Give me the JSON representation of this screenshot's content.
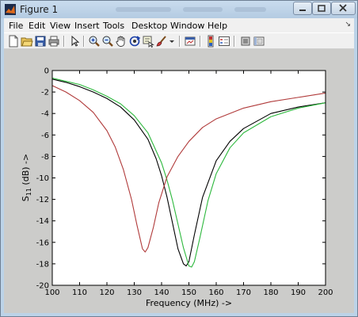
{
  "window": {
    "title": "Figure 1"
  },
  "menu": {
    "items": [
      "File",
      "Edit",
      "View",
      "Insert",
      "Tools",
      "Desktop",
      "Window",
      "Help"
    ]
  },
  "toolbar": {
    "icons": [
      "new-figure-icon",
      "open-file-icon",
      "save-icon",
      "print-icon",
      "edit-plot-arrow-icon",
      "zoom-in-icon",
      "zoom-out-icon",
      "pan-hand-icon",
      "rotate-3d-icon",
      "data-cursor-icon",
      "brush-icon",
      "link-plot-icon",
      "colorbar-icon",
      "legend-icon",
      "hide-plot-tools-icon",
      "show-plot-tools-icon"
    ]
  },
  "colors": {
    "titlebar": "#bcd3e8",
    "figure_bg": "#ccccca",
    "axes_bg": "#ffffff",
    "series_black": "#000000",
    "series_green": "#2db83d",
    "series_red": "#b03a3a"
  },
  "chart_data": {
    "type": "line",
    "title": "",
    "xlabel": "Frequency (MHz) ->",
    "ylabel": "S11 (dB) ->",
    "ylabel_main": "S",
    "ylabel_sub": "11",
    "ylabel_rest": " (dB) ->",
    "xlim": [
      100,
      200
    ],
    "ylim": [
      -20,
      0
    ],
    "xticks": [
      100,
      110,
      120,
      130,
      140,
      150,
      160,
      170,
      180,
      190,
      200
    ],
    "yticks": [
      0,
      -2,
      -4,
      -6,
      -8,
      -10,
      -12,
      -14,
      -16,
      -18,
      -20
    ],
    "grid": false,
    "series": [
      {
        "color": "#000000",
        "x": [
          100,
          105,
          110,
          115,
          120,
          125,
          130,
          135,
          138,
          140,
          142,
          144,
          146,
          148,
          149,
          150,
          152,
          155,
          160,
          165,
          170,
          180,
          190,
          200
        ],
        "y": [
          -0.8,
          -1.1,
          -1.5,
          -2.0,
          -2.6,
          -3.4,
          -4.6,
          -6.4,
          -8.2,
          -9.8,
          -11.8,
          -14.2,
          -16.6,
          -18.0,
          -18.2,
          -17.8,
          -15.3,
          -11.8,
          -8.4,
          -6.6,
          -5.4,
          -4.0,
          -3.4,
          -3.0
        ]
      },
      {
        "color": "#2db83d",
        "x": [
          100,
          105,
          110,
          115,
          120,
          125,
          130,
          135,
          140,
          142,
          144,
          146,
          148,
          150,
          151,
          152,
          154,
          157,
          160,
          165,
          170,
          180,
          190,
          200
        ],
        "y": [
          -0.7,
          -1.0,
          -1.3,
          -1.8,
          -2.4,
          -3.1,
          -4.2,
          -5.8,
          -8.6,
          -10.2,
          -12.1,
          -14.3,
          -16.5,
          -18.2,
          -18.3,
          -17.8,
          -15.6,
          -12.1,
          -9.6,
          -7.2,
          -5.8,
          -4.3,
          -3.5,
          -3.0
        ]
      },
      {
        "color": "#b03a3a",
        "x": [
          100,
          105,
          110,
          115,
          120,
          123,
          126,
          129,
          131,
          133,
          134,
          135,
          137,
          139,
          142,
          146,
          150,
          155,
          160,
          170,
          180,
          190,
          200
        ],
        "y": [
          -1.4,
          -2.0,
          -2.8,
          -3.9,
          -5.6,
          -7.1,
          -9.2,
          -12.0,
          -14.4,
          -16.6,
          -16.9,
          -16.5,
          -14.6,
          -12.3,
          -9.9,
          -8.0,
          -6.6,
          -5.3,
          -4.5,
          -3.5,
          -2.9,
          -2.5,
          -2.1
        ]
      }
    ]
  }
}
